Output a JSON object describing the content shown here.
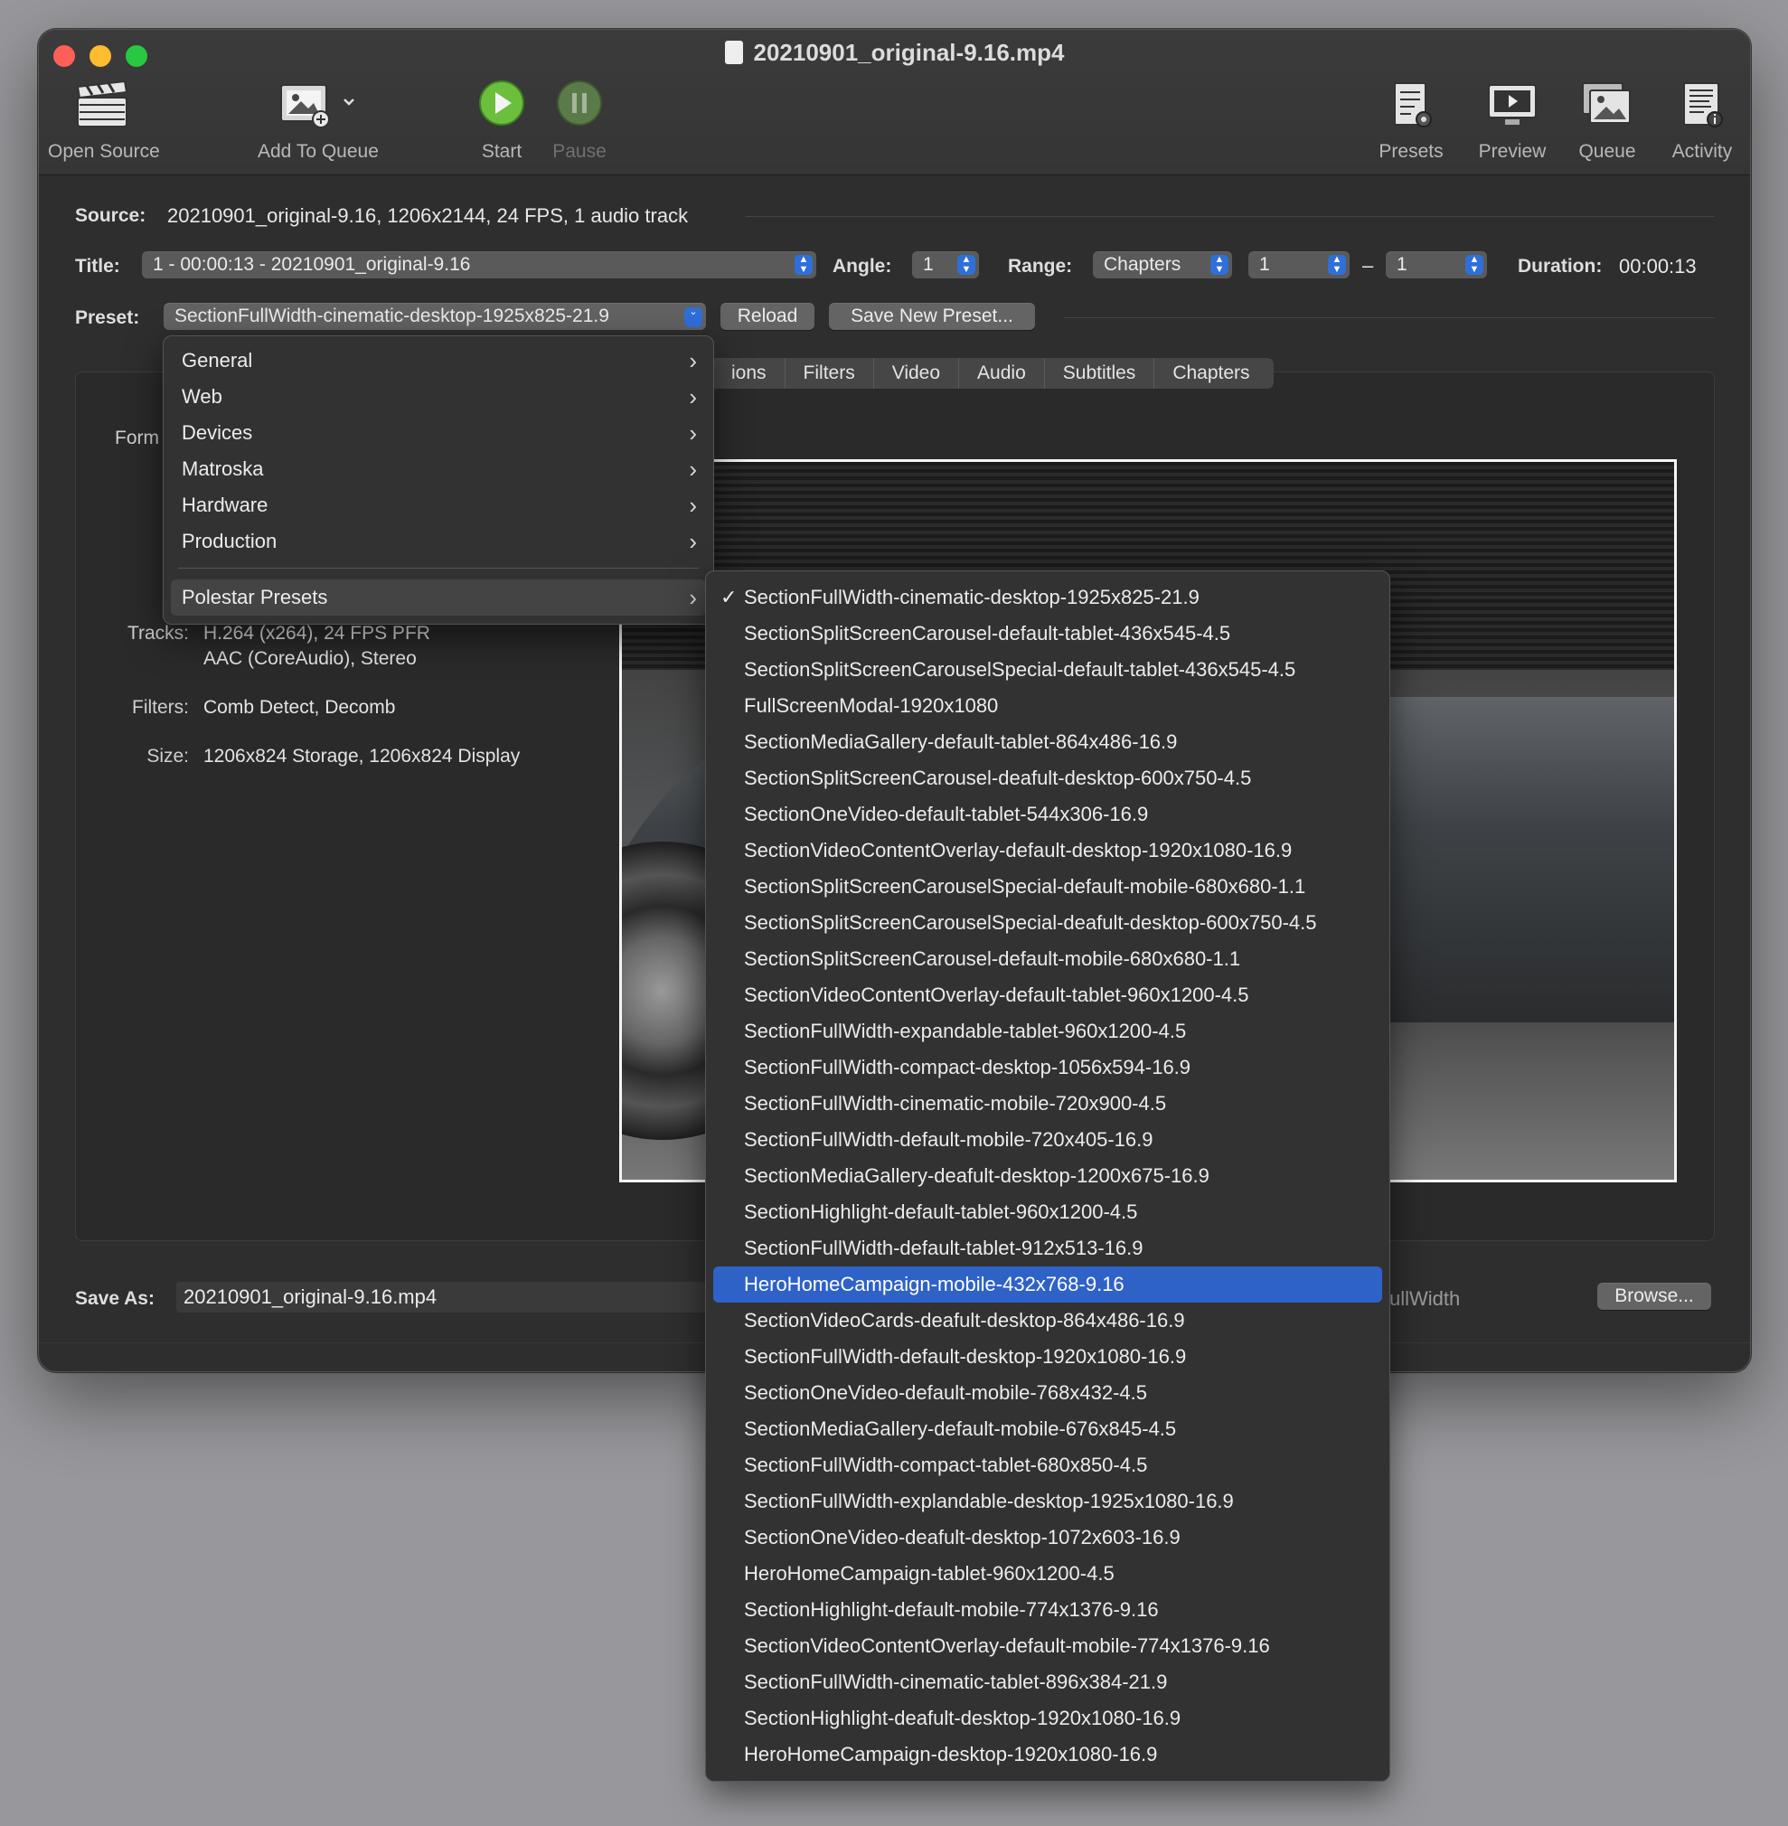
{
  "window": {
    "title": "20210901_original-9.16.mp4"
  },
  "toolbar": {
    "open_source": "Open Source",
    "add_to_queue": "Add To Queue",
    "start": "Start",
    "pause": "Pause",
    "presets": "Presets",
    "preview": "Preview",
    "queue": "Queue",
    "activity": "Activity"
  },
  "source": {
    "label": "Source:",
    "value": "20210901_original-9.16, 1206x2144, 24 FPS, 1 audio track"
  },
  "title_row": {
    "title_label": "Title:",
    "title_value": "1 - 00:00:13 - 20210901_original-9.16",
    "angle_label": "Angle:",
    "angle_value": "1",
    "range_label": "Range:",
    "range_type": "Chapters",
    "range_start": "1",
    "range_dash": "–",
    "range_end": "1",
    "duration_label": "Duration:",
    "duration_value": "00:00:13"
  },
  "preset_row": {
    "label": "Preset:",
    "value": "SectionFullWidth-cinematic-desktop-1925x825-21.9",
    "reload": "Reload",
    "save_new": "Save New Preset..."
  },
  "tabs": [
    "ions",
    "Filters",
    "Video",
    "Audio",
    "Subtitles",
    "Chapters"
  ],
  "summary": {
    "format_label": "Form",
    "tracks_label": "Tracks:",
    "tracks_line1": "H.264 (x264), 24 FPS PFR",
    "tracks_line2": "AAC (CoreAudio), Stereo",
    "filters_label": "Filters:",
    "filters_value": "Comb Detect, Decomb",
    "size_label": "Size:",
    "size_value": "1206x824 Storage, 1206x824 Display"
  },
  "save": {
    "label": "Save As:",
    "value": "20210901_original-9.16.mp4",
    "path_fragment": "ullWidth",
    "browse": "Browse..."
  },
  "preset_menu": {
    "categories": [
      "General",
      "Web",
      "Devices",
      "Matroska",
      "Hardware",
      "Production"
    ],
    "custom": "Polestar Presets"
  },
  "polestar_presets": [
    "SectionFullWidth-cinematic-desktop-1925x825-21.9",
    "SectionSplitScreenCarousel-default-tablet-436x545-4.5",
    "SectionSplitScreenCarouselSpecial-default-tablet-436x545-4.5",
    "FullScreenModal-1920x1080",
    "SectionMediaGallery-default-tablet-864x486-16.9",
    "SectionSplitScreenCarousel-deafult-desktop-600x750-4.5",
    "SectionOneVideo-default-tablet-544x306-16.9",
    "SectionVideoContentOverlay-default-desktop-1920x1080-16.9",
    "SectionSplitScreenCarouselSpecial-default-mobile-680x680-1.1",
    "SectionSplitScreenCarouselSpecial-deafult-desktop-600x750-4.5",
    "SectionSplitScreenCarousel-default-mobile-680x680-1.1",
    "SectionVideoContentOverlay-default-tablet-960x1200-4.5",
    "SectionFullWidth-expandable-tablet-960x1200-4.5",
    "SectionFullWidth-compact-desktop-1056x594-16.9",
    "SectionFullWidth-cinematic-mobile-720x900-4.5",
    "SectionFullWidth-default-mobile-720x405-16.9",
    "SectionMediaGallery-deafult-desktop-1200x675-16.9",
    "SectionHighlight-default-tablet-960x1200-4.5",
    "SectionFullWidth-default-tablet-912x513-16.9",
    "HeroHomeCampaign-mobile-432x768-9.16",
    "SectionVideoCards-deafult-desktop-864x486-16.9",
    "SectionFullWidth-default-desktop-1920x1080-16.9",
    "SectionOneVideo-default-mobile-768x432-4.5",
    "SectionMediaGallery-default-mobile-676x845-4.5",
    "SectionFullWidth-compact-tablet-680x850-4.5",
    "SectionFullWidth-explandable-desktop-1925x1080-16.9",
    "SectionOneVideo-deafult-desktop-1072x603-16.9",
    "HeroHomeCampaign-tablet-960x1200-4.5",
    "SectionHighlight-default-mobile-774x1376-9.16",
    "SectionVideoContentOverlay-default-mobile-774x1376-9.16",
    "SectionFullWidth-cinematic-tablet-896x384-21.9",
    "SectionHighlight-deafult-desktop-1920x1080-16.9",
    "HeroHomeCampaign-desktop-1920x1080-16.9"
  ],
  "checked_preset": "SectionFullWidth-cinematic-desktop-1925x825-21.9",
  "highlighted_preset": "HeroHomeCampaign-mobile-432x768-9.16",
  "colors": {
    "accent": "#2f62c7",
    "start_green": "#5cb85c"
  }
}
